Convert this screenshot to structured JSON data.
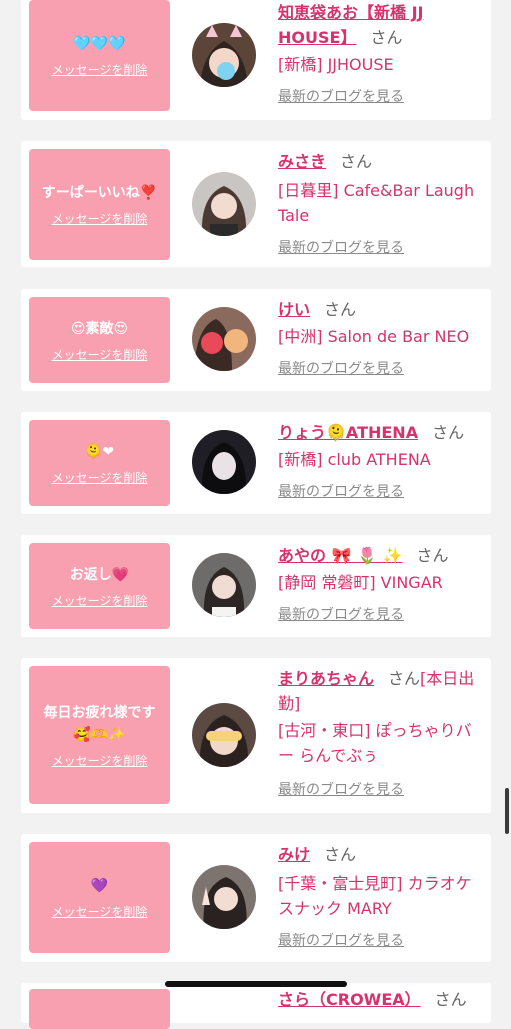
{
  "delete_label": "メッセージを削除",
  "san_label": "さん",
  "blog_label": "最新のブログを見る",
  "cards": [
    {
      "message": "🩵🩵🩵",
      "name": "知恵袋あお【新橋 JJ HOUSE】",
      "shop": "[新橋] JJHOUSE",
      "avatar_icon": "cat-ears-portrait"
    },
    {
      "message": "すーぱーいいね❣️",
      "name": "みさき",
      "shop": "[日暮里] Cafe&Bar Laugh Tale",
      "avatar_icon": "portrait"
    },
    {
      "message": "😍素敵😍",
      "name": "けい",
      "shop": "[中洲] Salon de Bar NEO",
      "avatar_icon": "strawberry-portrait"
    },
    {
      "message": "🫠❤",
      "name": "りょう🫠ATHENA",
      "shop": "[新橋] club ATHENA",
      "avatar_icon": "portrait"
    },
    {
      "message": "お返し💗",
      "name": "あやの 🎀 🌷 ✨",
      "shop": "[静岡 常磐町] VINGAR",
      "avatar_icon": "portrait"
    },
    {
      "message": "毎日お疲れ様です🥰🫶✨",
      "name": "まりあちゃん",
      "name_suffix": "[本日出勤]",
      "shop": "[古河・東口] ぽっちゃりバー らんでぶぅ",
      "avatar_icon": "happy-portrait"
    },
    {
      "message": "💜",
      "name": "みけ",
      "shop": "[千葉・富士見町] カラオケスナック MARY",
      "avatar_icon": "peace-sign-portrait"
    },
    {
      "message": "",
      "name": "さら（CROWEA）",
      "shop": "",
      "avatar_icon": "portrait"
    }
  ],
  "colors": {
    "accent": "#d6336c",
    "message_bg": "#f8a0b0",
    "page_bg": "#f2f2f2"
  }
}
